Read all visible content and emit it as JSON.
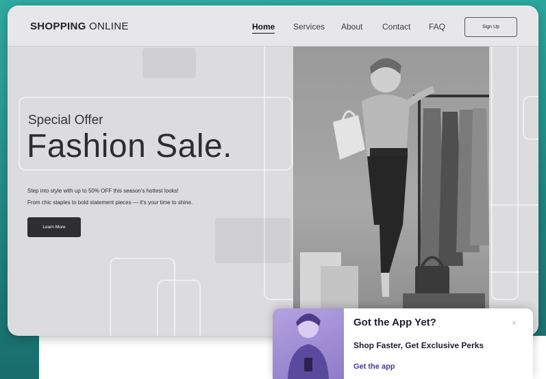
{
  "brand": {
    "bold": "SHOPPING",
    "rest": " ONLINE"
  },
  "nav": {
    "links": [
      {
        "label": "Home"
      },
      {
        "label": "Services"
      },
      {
        "label": "About"
      },
      {
        "label": "Contact"
      },
      {
        "label": "FAQ"
      }
    ],
    "signup_label": "Sign Up"
  },
  "hero": {
    "eyebrow": "Special Offer",
    "headline": "Fashion Sale.",
    "description_lines": [
      "Step into style with up to 50% OFF this season's hottest looks!",
      "From chic staples to bold statement pieces — it's your time to shine."
    ],
    "cta_label": "Learn More"
  },
  "popup": {
    "title": "Got the App Yet?",
    "subtitle": "Shop Faster, Get Exclusive Perks",
    "link_label": "Get the app",
    "close_icon": "×"
  },
  "colors": {
    "background": "#1f8b85",
    "card": "#dcdcdf",
    "accent_dark": "#2e2e30",
    "popup_purple": "#8f7cc9",
    "popup_link": "#4a3a94"
  },
  "icons": [
    "close-icon"
  ]
}
